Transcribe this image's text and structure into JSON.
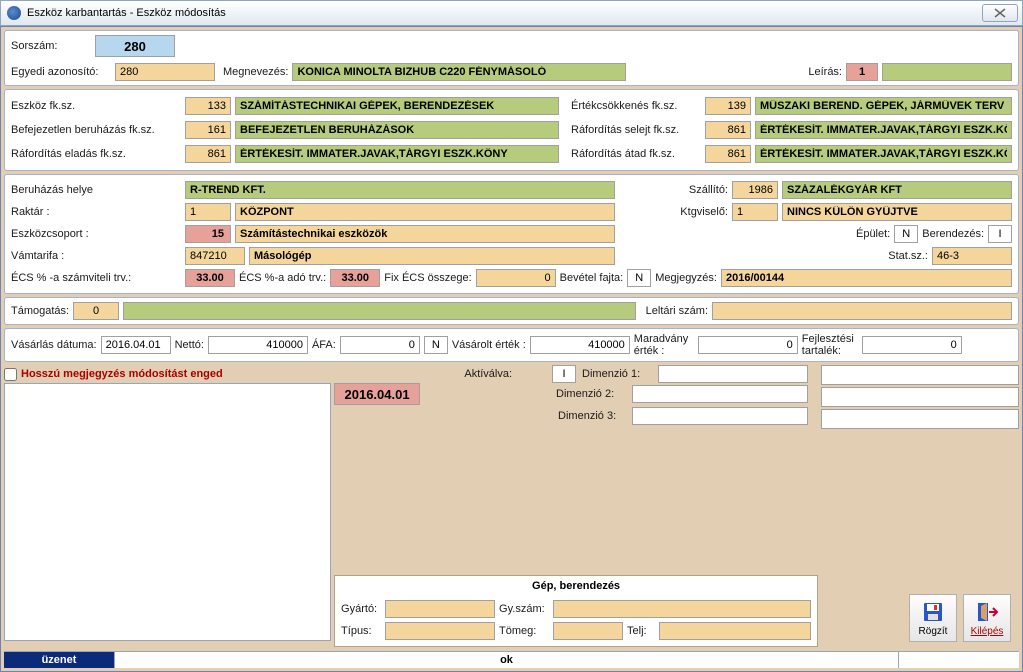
{
  "title": "Eszköz karbantartás - Eszköz módosítás",
  "header": {
    "sorszam_label": "Sorszám:",
    "sorszam": "280",
    "egyedi_label": "Egyedi azonosító:",
    "egyedi": "280",
    "megnevezes_label": "Megnevezés:",
    "megnevezes": "KONICA MINOLTA BIZHUB C220 FÉNYMÁSOLÓ",
    "leiras_label": "Leírás:",
    "leiras_code": "1",
    "leiras_text": ""
  },
  "accounts": [
    {
      "l1": "Eszköz fk.sz.",
      "c1": "133",
      "n1": "SZÁMÍTÁSTECHNIKAI GÉPEK, BERENDEZÉSEK",
      "l2": "Értékcsökkenés fk.sz.",
      "c2": "139",
      "n2": "MŰSZAKI BEREND. GÉPEK, JÁRMŰVEK TERV SZEI"
    },
    {
      "l1": "Befejezetlen beruházás fk.sz.",
      "c1": "161",
      "n1": "BEFEJEZETLEN BERUHÁZÁSOK",
      "l2": "Ráfordítás selejt fk.sz.",
      "c2": "861",
      "n2": "ÉRTÉKESÍT. IMMATER.JAVAK,TÁRGYI ESZK.KÖNY"
    },
    {
      "l1": "Ráfordítás eladás fk.sz.",
      "c1": "861",
      "n1": "ÉRTÉKESÍT. IMMATER.JAVAK,TÁRGYI ESZK.KÖNY",
      "l2": "Ráfordítás átad fk.sz.",
      "c2": "861",
      "n2": "ÉRTÉKESÍT. IMMATER.JAVAK,TÁRGYI ESZK.KÖNY"
    }
  ],
  "loc": {
    "beruhazas_label": "Beruházás helye",
    "beruhazas_name": "R-TREND KFT.",
    "szallito_label": "Szállító:",
    "szallito_code": "1986",
    "szallito_name": "SZÁZALÉKGYÁR KFT",
    "raktar_label": "Raktár :",
    "raktar_code": "1",
    "raktar_name": "KÖZPONT",
    "ktgviselo_label": "Ktgviselő:",
    "ktgviselo_code": "1",
    "ktgviselo_name": "NINCS KÜLÖN GYŰJTVE",
    "eszkozcsoport_label": "Eszközcsoport :",
    "eszkozcsoport_code": "15",
    "eszkozcsoport_name": "Számítástechnikai eszközök",
    "epulet_label": "Épület:",
    "epulet": "N",
    "berendezes_label": "Berendezés:",
    "berendezes": "I",
    "vamtarifa_label": "Vámtarifa :",
    "vamtarifa_code": "847210",
    "vamtarifa_name": "Másológép",
    "statsz_label": "Stat.sz.:",
    "statsz": "46-3",
    "ecs_szamv_label": "ÉCS % -a számviteli trv.:",
    "ecs_szamv": "33.00",
    "ecs_ado_label": "ÉCS %-a adó trv.:",
    "ecs_ado": "33.00",
    "fix_ecs_label": "Fix ÉCS összege:",
    "fix_ecs": "0",
    "bevetel_label": "Bevétel fajta:",
    "bevetel": "N",
    "megjegyzes_label": "Megjegyzés:",
    "megjegyzes": "2016/00144"
  },
  "tamogatas": {
    "label": "Támogatás:",
    "code": "0",
    "text": "",
    "leltari_label": "Leltári szám:",
    "leltari": ""
  },
  "vasarlas": {
    "datum_label": "Vásárlás dátuma:",
    "datum": "2016.04.01",
    "netto_label": "Nettó:",
    "netto": "410000",
    "afa_label": "ÁFA:",
    "afa": "0",
    "afa_flag": "N",
    "vasarolt_label": "Vásárolt érték :",
    "vasarolt": "410000",
    "maradvany_label": "Maradvány érték :",
    "maradvany": "0",
    "fejlesztesi_label": "Fejlesztési tartalék:",
    "fejlesztesi": "0"
  },
  "notes": {
    "checkbox_label": "Hosszú megjegyzés módosítást enged",
    "aktivalva_label": "Aktíválva:",
    "aktivalva": "2016.04.01",
    "dim_flag": "I",
    "dim1_label": "Dimenzió 1:",
    "dim2_label": "Dimenzió 2:",
    "dim3_label": "Dimenzió 3:"
  },
  "gep": {
    "title": "Gép, berendezés",
    "gyarto_label": "Gyártó:",
    "gyszam_label": "Gy.szám:",
    "tipus_label": "Típus:",
    "tomeg_label": "Tömeg:",
    "telj_label": "Telj:"
  },
  "buttons": {
    "rogzit": "Rögzít",
    "kilepes": "Kilépés"
  },
  "status": {
    "left": "üzenet",
    "mid": "ok"
  }
}
